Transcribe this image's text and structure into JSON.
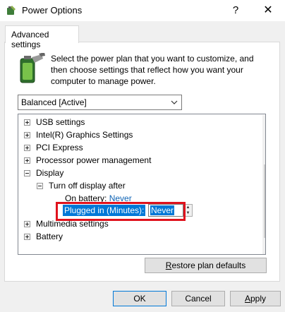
{
  "window": {
    "title": "Power Options",
    "help_icon": "?",
    "close_icon": "✕"
  },
  "tab": {
    "label": "Advanced settings"
  },
  "intro": {
    "text": "Select the power plan that you want to customize, and then choose settings that reflect how you want your computer to manage power."
  },
  "plan_select": {
    "value": "Balanced [Active]"
  },
  "tree": {
    "items": {
      "usb": "USB settings",
      "graphics": "Intel(R) Graphics Settings",
      "pci": "PCI Express",
      "processor": "Processor power management",
      "display": "Display",
      "turn_off": "Turn off display after",
      "on_battery_label": "On battery:",
      "on_battery_value": "Never",
      "plugged_label": "Plugged in (Minutes):",
      "plugged_value": "Never",
      "multimedia": "Multimedia settings",
      "battery": "Battery"
    }
  },
  "buttons": {
    "restore_first": "R",
    "restore_rest": "estore plan defaults",
    "ok": "OK",
    "cancel": "Cancel",
    "apply_first": "A",
    "apply_rest": "pply"
  },
  "colors": {
    "selection": "#0078d7",
    "highlight_box": "#e0121d",
    "link_value": "#0e63b5"
  }
}
